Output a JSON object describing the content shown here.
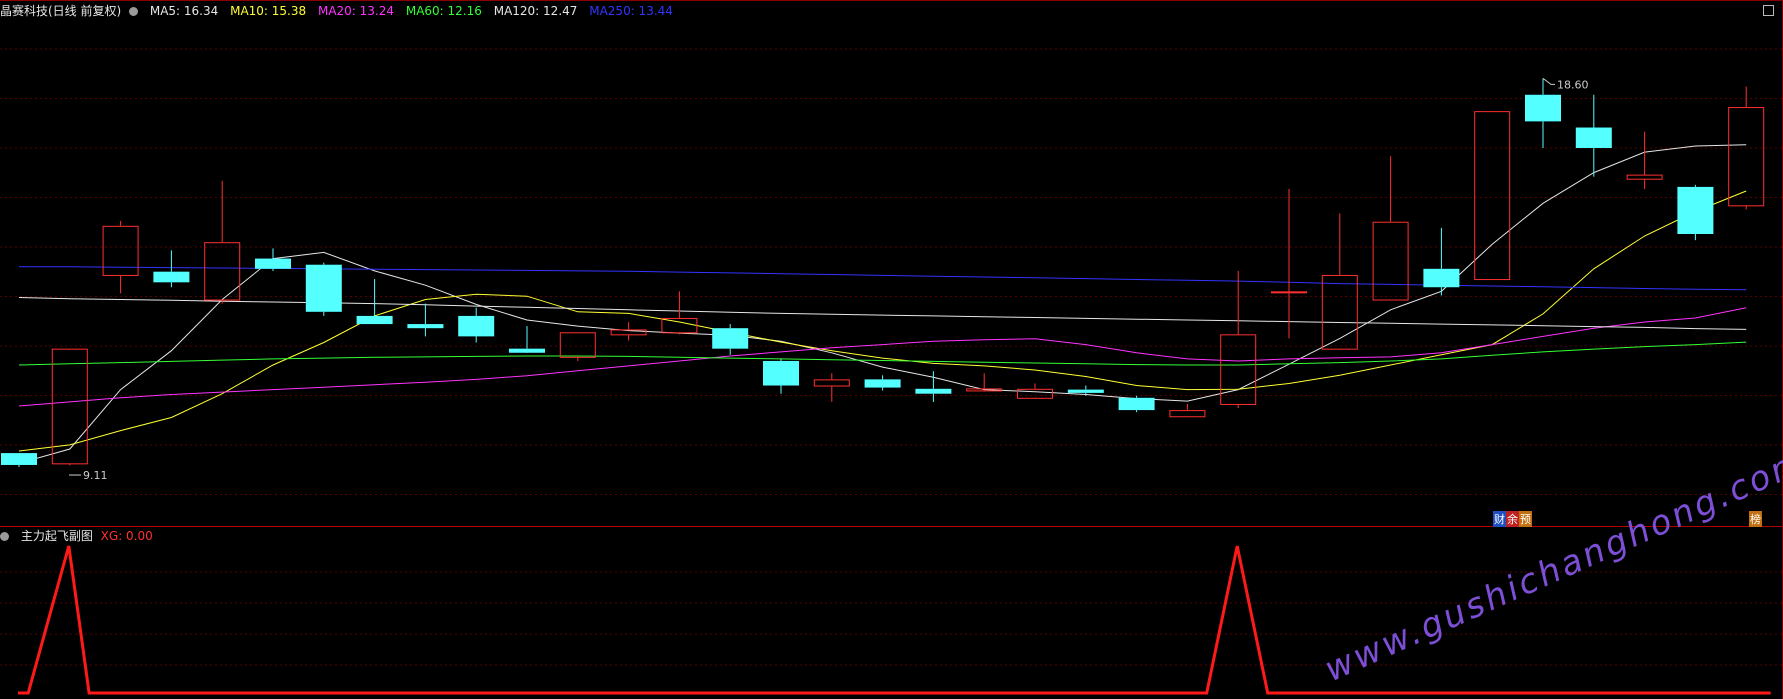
{
  "header": {
    "stock_title": "晶赛科技(日线 前复权)",
    "ma_items": [
      {
        "label": "MA5: 16.34",
        "color": "#e6e6e6"
      },
      {
        "label": "MA10: 15.38",
        "color": "#ffff33"
      },
      {
        "label": "MA20: 13.24",
        "color": "#ff33ff"
      },
      {
        "label": "MA60: 12.16",
        "color": "#33ff33"
      },
      {
        "label": "MA120: 12.47",
        "color": "#e6e6e6"
      },
      {
        "label": "MA250: 13.44",
        "color": "#3333ff"
      }
    ]
  },
  "sub_header": {
    "indicator_name": "主力起飞副图",
    "xg_label": "XG: 0.00"
  },
  "badges": {
    "cai": "财",
    "jin": "余",
    "yu": "预",
    "bang": "榜"
  },
  "watermark": "www.gushichanghong.com",
  "colors": {
    "up": "#ff3030",
    "down": "#54ffff",
    "grid": "#5a0000",
    "xg": "#ff1a1a"
  },
  "chart_data": [
    {
      "type": "candlestick",
      "ylim": [
        8.5,
        19.0
      ],
      "annotations": [
        {
          "text": "18.60",
          "index": 30,
          "value": 18.6
        },
        {
          "text": "9.11",
          "index": 0,
          "value": 9.11
        }
      ],
      "candles": [
        {
          "o": 9.45,
          "h": 9.45,
          "l": 9.11,
          "c": 9.16
        },
        {
          "o": 9.2,
          "h": 12.0,
          "l": 9.15,
          "c": 12.0
        },
        {
          "o": 13.8,
          "h": 15.12,
          "l": 13.35,
          "c": 15.0
        },
        {
          "o": 13.88,
          "h": 14.4,
          "l": 13.5,
          "c": 13.62
        },
        {
          "o": 13.2,
          "h": 16.1,
          "l": 13.1,
          "c": 14.6
        },
        {
          "o": 14.2,
          "h": 14.45,
          "l": 13.9,
          "c": 13.95
        },
        {
          "o": 14.05,
          "h": 14.1,
          "l": 12.8,
          "c": 12.9
        },
        {
          "o": 12.8,
          "h": 13.7,
          "l": 12.6,
          "c": 12.6
        },
        {
          "o": 12.6,
          "h": 13.1,
          "l": 12.3,
          "c": 12.5
        },
        {
          "o": 12.8,
          "h": 13.0,
          "l": 12.15,
          "c": 12.3
        },
        {
          "o": 12.0,
          "h": 12.55,
          "l": 11.95,
          "c": 11.9
        },
        {
          "o": 11.8,
          "h": 12.4,
          "l": 11.7,
          "c": 12.4
        },
        {
          "o": 12.35,
          "h": 12.65,
          "l": 12.2,
          "c": 12.47
        },
        {
          "o": 12.4,
          "h": 13.4,
          "l": 12.35,
          "c": 12.75
        },
        {
          "o": 12.5,
          "h": 12.6,
          "l": 11.85,
          "c": 12.0
        },
        {
          "o": 11.7,
          "h": 11.75,
          "l": 10.9,
          "c": 11.1
        },
        {
          "o": 11.1,
          "h": 11.4,
          "l": 10.7,
          "c": 11.25
        },
        {
          "o": 11.25,
          "h": 11.35,
          "l": 10.98,
          "c": 11.05
        },
        {
          "o": 11.02,
          "h": 11.45,
          "l": 10.7,
          "c": 10.9
        },
        {
          "o": 10.98,
          "h": 11.4,
          "l": 10.95,
          "c": 11.03
        },
        {
          "o": 10.8,
          "h": 11.15,
          "l": 10.78,
          "c": 11.02
        },
        {
          "o": 11.0,
          "h": 11.1,
          "l": 10.85,
          "c": 10.92
        },
        {
          "o": 10.8,
          "h": 10.85,
          "l": 10.45,
          "c": 10.5
        },
        {
          "o": 10.35,
          "h": 10.65,
          "l": 10.35,
          "c": 10.5
        },
        {
          "o": 10.65,
          "h": 13.9,
          "l": 10.55,
          "c": 12.35
        },
        {
          "o": 13.4,
          "h": 15.9,
          "l": 12.25,
          "c": 13.4
        },
        {
          "o": 12.0,
          "h": 15.3,
          "l": 11.98,
          "c": 13.8
        },
        {
          "o": 13.2,
          "h": 16.7,
          "l": 13.2,
          "c": 15.1
        },
        {
          "o": 13.95,
          "h": 14.95,
          "l": 13.3,
          "c": 13.5
        },
        {
          "o": 13.7,
          "h": 17.8,
          "l": 13.7,
          "c": 17.8
        },
        {
          "o": 18.2,
          "h": 18.6,
          "l": 16.9,
          "c": 17.55
        },
        {
          "o": 17.4,
          "h": 18.2,
          "l": 16.2,
          "c": 16.9
        },
        {
          "o": 16.15,
          "h": 17.3,
          "l": 15.9,
          "c": 16.25
        },
        {
          "o": 15.95,
          "h": 16.0,
          "l": 14.65,
          "c": 14.8
        },
        {
          "o": 15.5,
          "h": 18.4,
          "l": 15.4,
          "c": 17.9
        }
      ],
      "ma_lines": [
        {
          "name": "MA5",
          "color": "#e6e6e6",
          "values": [
            9.2,
            9.55,
            11.0,
            11.95,
            13.2,
            14.2,
            14.35,
            13.9,
            13.55,
            13.08,
            12.7,
            12.55,
            12.44,
            12.38,
            12.33,
            12.18,
            11.9,
            11.55,
            11.3,
            11.0,
            10.95,
            10.88,
            10.78,
            10.72,
            11.0,
            11.62,
            12.25,
            12.95,
            13.4,
            14.55,
            15.55,
            16.3,
            16.8,
            16.95,
            16.98
          ]
        },
        {
          "name": "MA10",
          "color": "#ffff33",
          "values": [
            9.5,
            9.65,
            10.0,
            10.32,
            10.9,
            11.6,
            12.15,
            12.8,
            13.2,
            13.33,
            13.28,
            12.9,
            12.86,
            12.65,
            12.4,
            12.16,
            11.95,
            11.77,
            11.64,
            11.58,
            11.48,
            11.32,
            11.1,
            11.0,
            11.01,
            11.15,
            11.35,
            11.6,
            11.85,
            12.1,
            12.85,
            13.95,
            14.75,
            15.35,
            15.85
          ]
        },
        {
          "name": "MA20",
          "color": "#ff33ff",
          "values": [
            10.6,
            10.7,
            10.8,
            10.88,
            10.94,
            11.0,
            11.06,
            11.12,
            11.18,
            11.25,
            11.34,
            11.46,
            11.58,
            11.7,
            11.82,
            11.92,
            12.02,
            12.1,
            12.18,
            12.22,
            12.24,
            12.1,
            11.9,
            11.75,
            11.7,
            11.75,
            11.78,
            11.8,
            11.9,
            12.1,
            12.3,
            12.5,
            12.65,
            12.75,
            13.0
          ]
        },
        {
          "name": "MA60",
          "color": "#33ff33",
          "values": [
            11.6,
            11.63,
            11.66,
            11.69,
            11.72,
            11.75,
            11.77,
            11.79,
            11.8,
            11.81,
            11.82,
            11.82,
            11.81,
            11.79,
            11.77,
            11.75,
            11.73,
            11.71,
            11.69,
            11.67,
            11.65,
            11.63,
            11.61,
            11.6,
            11.6,
            11.63,
            11.66,
            11.7,
            11.75,
            11.84,
            11.92,
            11.99,
            12.05,
            12.1,
            12.16
          ]
        },
        {
          "name": "MA120",
          "color": "#e6e6e6",
          "values": [
            13.25,
            13.22,
            13.2,
            13.18,
            13.16,
            13.14,
            13.12,
            13.1,
            13.07,
            13.04,
            13.01,
            12.98,
            12.95,
            12.92,
            12.89,
            12.86,
            12.84,
            12.82,
            12.8,
            12.78,
            12.76,
            12.74,
            12.72,
            12.7,
            12.68,
            12.66,
            12.64,
            12.62,
            12.6,
            12.58,
            12.56,
            12.54,
            12.52,
            12.49,
            12.47
          ]
        },
        {
          "name": "MA250",
          "color": "#3333ff",
          "values": [
            14.0,
            14.0,
            13.99,
            13.98,
            13.97,
            13.96,
            13.95,
            13.94,
            13.93,
            13.92,
            13.91,
            13.9,
            13.89,
            13.87,
            13.85,
            13.83,
            13.81,
            13.79,
            13.77,
            13.75,
            13.73,
            13.71,
            13.69,
            13.67,
            13.65,
            13.62,
            13.59,
            13.57,
            13.55,
            13.53,
            13.51,
            13.49,
            13.47,
            13.45,
            13.44
          ]
        }
      ]
    },
    {
      "type": "line",
      "name": "XG",
      "ylim": [
        0,
        1
      ],
      "x": [
        0,
        0.2,
        1.0,
        1.4,
        23.0,
        23.4,
        24.0,
        24.6,
        34.5
      ],
      "values": [
        0,
        0,
        1,
        0,
        0,
        0,
        1,
        0,
        0
      ]
    }
  ]
}
